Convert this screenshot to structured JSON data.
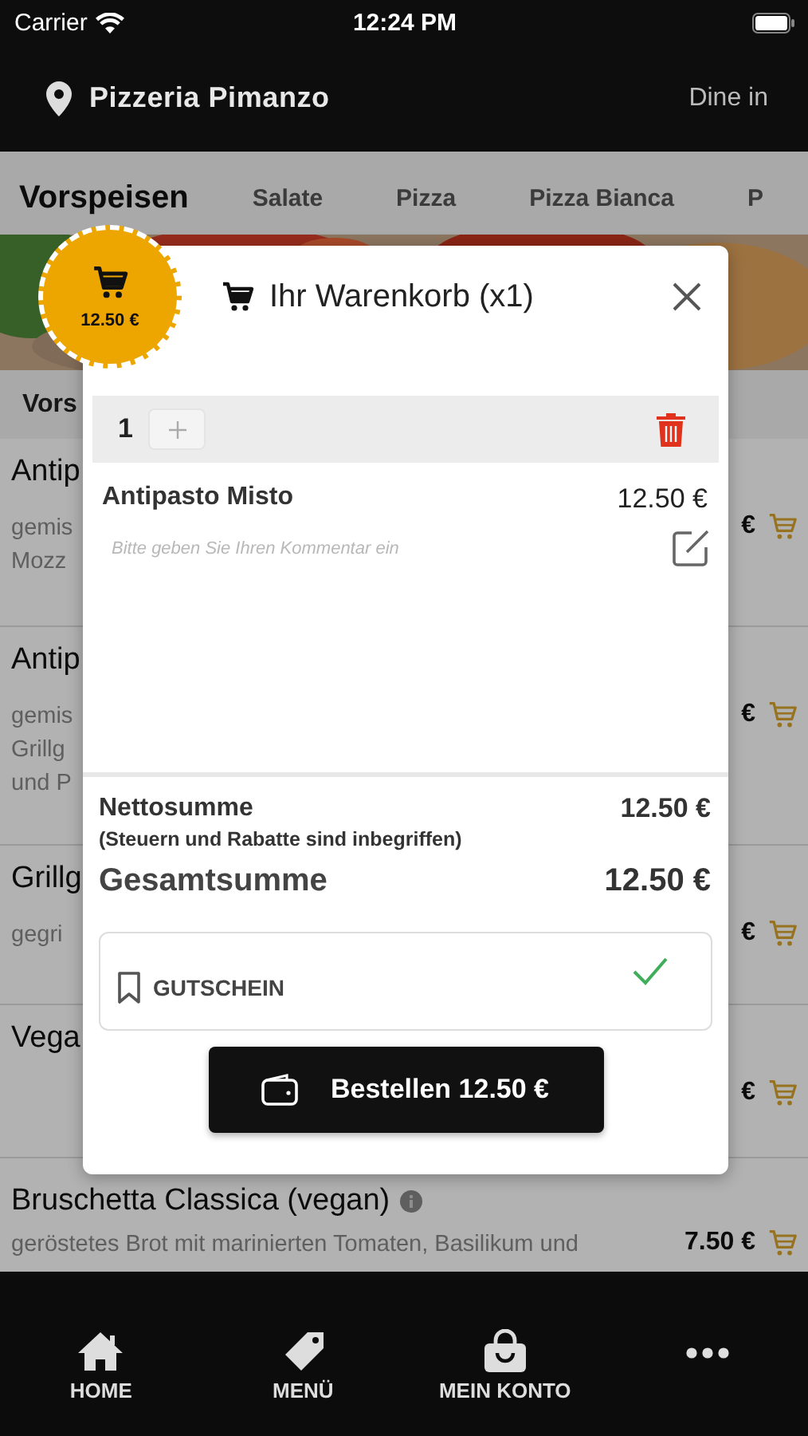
{
  "status_bar": {
    "carrier": "Carrier",
    "time": "12:24 PM"
  },
  "header": {
    "restaurant": "Pizzeria Pimanzo",
    "mode": "Dine in"
  },
  "categories": [
    {
      "label": "Vorspeisen",
      "selected": true
    },
    {
      "label": "Salate",
      "selected": false
    },
    {
      "label": "Pizza",
      "selected": false
    },
    {
      "label": "Pizza Bianca",
      "selected": false
    },
    {
      "label": "P",
      "selected": false
    }
  ],
  "section_title": "Vors",
  "menu_items": [
    {
      "title": "Antip",
      "description": [
        "gemis",
        "Mozz"
      ],
      "price": "€",
      "info": false
    },
    {
      "title": "Antip",
      "description": [
        "gemis",
        "Grillg",
        "und P"
      ],
      "price": "€",
      "info": false
    },
    {
      "title": "Grillg",
      "description": [
        "gegri"
      ],
      "price": "€",
      "info": false
    },
    {
      "title": "Vega",
      "price": "€",
      "info": false
    },
    {
      "title": "Bruschetta Classica (vegan)",
      "description": [
        "geröstetes Brot mit marinierten Tomaten, Basilikum und"
      ],
      "price": "7.50 €",
      "info": true
    }
  ],
  "cart_badge": {
    "total": "12.50 €"
  },
  "cart": {
    "title": "Ihr Warenkorb (x1)",
    "lines": [
      {
        "quantity": "1",
        "name": "Antipasto Misto",
        "price": "12.50 €",
        "comment_placeholder": "Bitte geben Sie Ihren Kommentar ein"
      }
    ],
    "net_label": "Nettosumme",
    "net_value": "12.50 €",
    "net_note": "(Steuern und Rabatte sind inbegriffen)",
    "total_label": "Gesamtsumme",
    "total_value": "12.50 €",
    "voucher": {
      "label": "GUTSCHEIN",
      "applied": true
    },
    "order_button": "Bestellen 12.50 €"
  },
  "tab_bar": [
    {
      "label": "HOME",
      "kind": "home"
    },
    {
      "label": "MENÜ",
      "kind": "tag"
    },
    {
      "label": "MEIN KONTO",
      "kind": "bag"
    },
    {
      "kind": "more"
    }
  ]
}
